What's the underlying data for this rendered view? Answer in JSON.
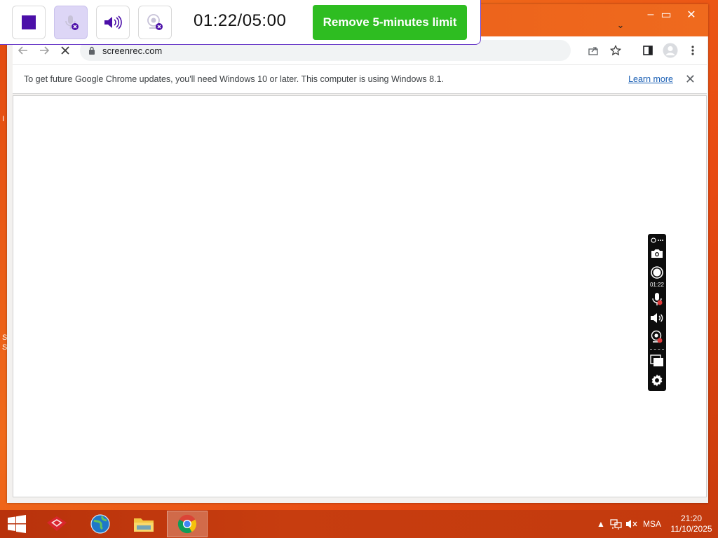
{
  "recorder": {
    "timer": "01:22/05:00",
    "remove_limit_label": "Remove 5-minutes limit",
    "side_panel_time": "01:22"
  },
  "browser": {
    "url": "screenrec.com",
    "infobar_message": "To get future Google Chrome updates, you'll need Windows 10 or later. This computer is using Windows 8.1.",
    "infobar_link": "Learn more",
    "window_controls": {
      "minimize": "–",
      "maximize": "▭",
      "close": "✕"
    }
  },
  "desktop": {
    "edge_glyphs": [
      "I",
      "S",
      "S"
    ]
  },
  "taskbar": {
    "language": "MSA",
    "time": "21:20",
    "date": "11/10/2025"
  },
  "colors": {
    "accent_purple": "#4b0fa8",
    "remove_limit_green": "#2ebd21",
    "desktop_orange": "#e84a12"
  }
}
